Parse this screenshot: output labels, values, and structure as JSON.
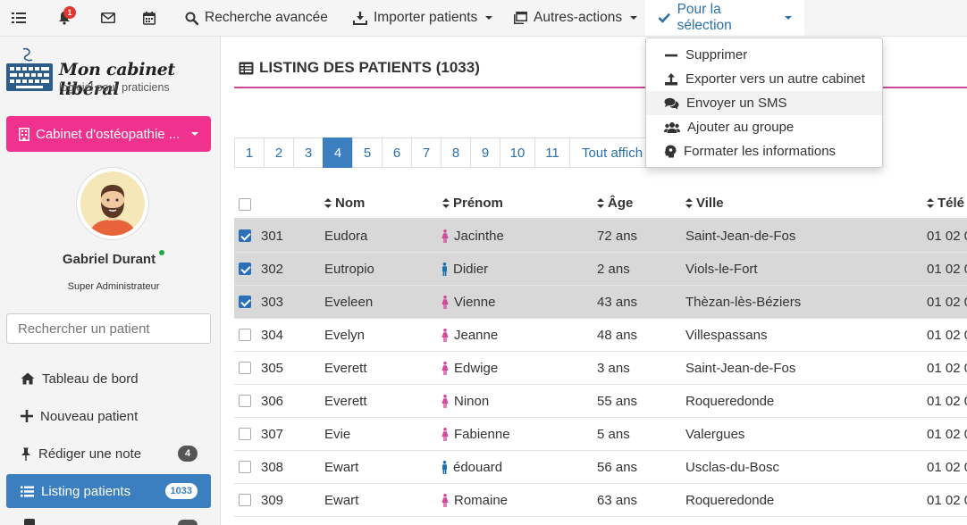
{
  "topbar": {
    "notification_count": "1",
    "advanced_search": "Recherche avancée",
    "import_patients": "Importer patients",
    "other_actions": "Autres-actions",
    "for_selection": "Pour la sélection"
  },
  "logo": {
    "title": "Mon cabinet libéral",
    "subtitle": "logiciel pour praticiens"
  },
  "sidebar": {
    "cabinet_label": "Cabinet d'ostéopathie ...",
    "user_name": "Gabriel Durant",
    "user_role": "Super Administrateur",
    "search_placeholder": "Rechercher un patient",
    "nav": [
      {
        "label": "Tableau de bord",
        "icon": "home-icon"
      },
      {
        "label": "Nouveau patient",
        "icon": "plus-icon"
      },
      {
        "label": "Rédiger une note",
        "icon": "pin-icon",
        "badge": "4"
      },
      {
        "label": "Listing patients",
        "icon": "list-icon",
        "badge": "1033",
        "active": true
      }
    ]
  },
  "main": {
    "title": "LISTING DES PATIENTS (1033)",
    "pages": [
      "1",
      "2",
      "3",
      "4",
      "5",
      "6",
      "7",
      "8",
      "9",
      "10",
      "11",
      "Tout affich"
    ],
    "active_page": "4",
    "columns": {
      "nom": "Nom",
      "prenom": "Prénom",
      "age": "Âge",
      "ville": "Ville",
      "tel": "Télé"
    },
    "rows": [
      {
        "id": "301",
        "nom": "Eudora",
        "prenom": "Jacinthe",
        "gender": "f",
        "age": "72 ans",
        "ville": "Saint-Jean-de-Fos",
        "tel": "01 02 0",
        "selected": true
      },
      {
        "id": "302",
        "nom": "Eutropio",
        "prenom": "Didier",
        "gender": "m",
        "age": "2 ans",
        "ville": "Viols-le-Fort",
        "tel": "01 02 0",
        "selected": true
      },
      {
        "id": "303",
        "nom": "Eveleen",
        "prenom": "Vienne",
        "gender": "f",
        "age": "43 ans",
        "ville": "Thèzan-lès-Béziers",
        "tel": "01 02 0",
        "selected": true
      },
      {
        "id": "304",
        "nom": "Evelyn",
        "prenom": "Jeanne",
        "gender": "f",
        "age": "48 ans",
        "ville": "Villespassans",
        "tel": "01 02 0",
        "selected": false
      },
      {
        "id": "305",
        "nom": "Everett",
        "prenom": "Edwige",
        "gender": "f",
        "age": "3 ans",
        "ville": "Saint-Jean-de-Fos",
        "tel": "01 02 0",
        "selected": false
      },
      {
        "id": "306",
        "nom": "Everett",
        "prenom": "Ninon",
        "gender": "f",
        "age": "55 ans",
        "ville": "Roqueredonde",
        "tel": "01 02 0",
        "selected": false
      },
      {
        "id": "307",
        "nom": "Evie",
        "prenom": "Fabienne",
        "gender": "f",
        "age": "5 ans",
        "ville": "Valergues",
        "tel": "01 02 0",
        "selected": false
      },
      {
        "id": "308",
        "nom": "Ewart",
        "prenom": "édouard",
        "gender": "m",
        "age": "56 ans",
        "ville": "Usclas-du-Bosc",
        "tel": "01 02 0",
        "selected": false
      },
      {
        "id": "309",
        "nom": "Ewart",
        "prenom": "Romaine",
        "gender": "f",
        "age": "63 ans",
        "ville": "Roqueredonde",
        "tel": "01 02 0",
        "selected": false
      }
    ]
  },
  "dropdown": {
    "items": [
      {
        "label": "Supprimer",
        "icon": "minus-icon"
      },
      {
        "label": "Exporter vers un autre cabinet",
        "icon": "upload-icon"
      },
      {
        "label": "Envoyer un SMS",
        "icon": "comments-icon"
      },
      {
        "label": "Ajouter au groupe",
        "icon": "users-icon"
      },
      {
        "label": "Formater les informations",
        "icon": "brain-icon"
      }
    ]
  },
  "colors": {
    "accent_blue": "#3c7fc0",
    "pink": "#f0318e",
    "female": "#d04b9c",
    "male": "#1f6fa8"
  }
}
